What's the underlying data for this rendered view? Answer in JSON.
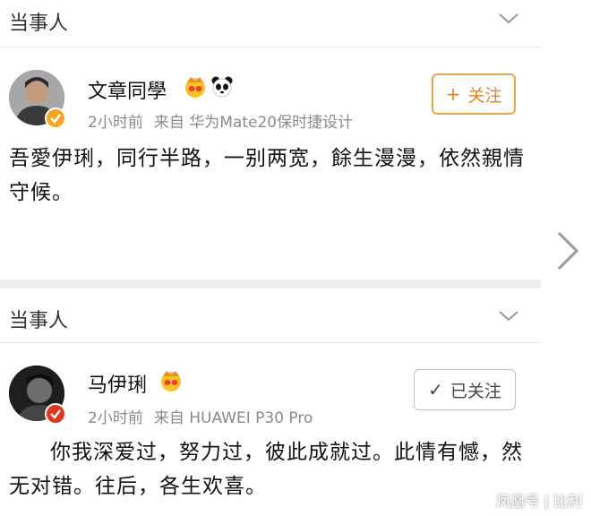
{
  "posts": [
    {
      "section_title": "当事人",
      "user_name": "文章同學",
      "emoji_icons": [
        "crown-face-icon",
        "panda-icon"
      ],
      "time": "2小时前",
      "source": "来自 华为Mate20保时捷设计",
      "follow_symbol": "+",
      "follow_label": "关注",
      "body": "吾愛伊琍，同行半路，一别两宽，餘生漫漫，依然親情守候。",
      "verified_color": "#f5a623"
    },
    {
      "section_title": "当事人",
      "user_name": "马伊琍",
      "emoji_icons": [
        "crown-face-icon"
      ],
      "time": "2小时前",
      "source": "来自 HUAWEI P30 Pro",
      "follow_symbol": "✓",
      "follow_label": "已关注",
      "body": "你我深爱过，努力过，彼此成就过。此情有憾，然无对错。往后，各生欢喜。",
      "verified_color": "#e0351f"
    }
  ],
  "watermark": "凤凰号 | 比利",
  "colors": {
    "follow_accent": "#e8811a",
    "follow_border": "#e8a54b",
    "meta": "#8a8a8a"
  }
}
